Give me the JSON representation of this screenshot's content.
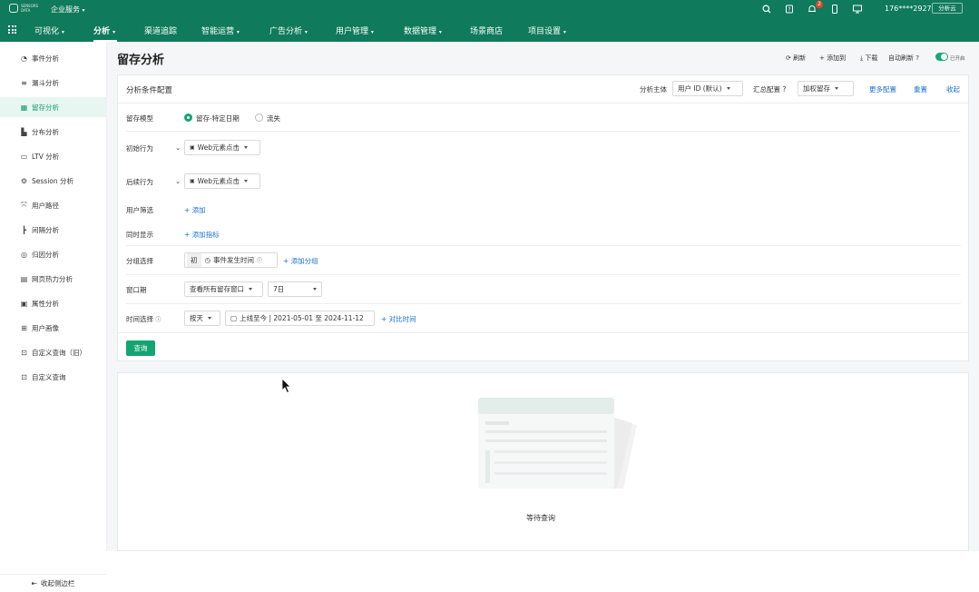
{
  "topbar": {
    "enterprise_label": "企业服务",
    "notification_count": "2",
    "account_text": "176****2927",
    "account_button": "分析云",
    "logo_text": "SENSORS DATA"
  },
  "nav": {
    "items": [
      {
        "label": "可视化"
      },
      {
        "label": "分析"
      },
      {
        "label": "渠道追踪"
      },
      {
        "label": "智能运营"
      },
      {
        "label": "广告分析"
      },
      {
        "label": "用户管理"
      },
      {
        "label": "数据管理"
      },
      {
        "label": "场景商店"
      },
      {
        "label": "项目设置"
      }
    ]
  },
  "sidebar": {
    "items": [
      {
        "label": "事件分析",
        "icon": "event-icon"
      },
      {
        "label": "漏斗分析",
        "icon": "funnel-icon"
      },
      {
        "label": "留存分析",
        "icon": "retention-icon"
      },
      {
        "label": "分布分析",
        "icon": "distribution-icon"
      },
      {
        "label": "LTV 分析",
        "icon": "ltv-icon"
      },
      {
        "label": "Session 分析",
        "icon": "session-icon"
      },
      {
        "label": "用户路径",
        "icon": "path-icon"
      },
      {
        "label": "间隔分析",
        "icon": "interval-icon"
      },
      {
        "label": "归因分析",
        "icon": "attribution-icon"
      },
      {
        "label": "网页热力分析",
        "icon": "heatmap-icon"
      },
      {
        "label": "属性分析",
        "icon": "property-icon"
      },
      {
        "label": "用户画像",
        "icon": "profile-icon"
      },
      {
        "label": "自定义查询（旧）",
        "icon": "custom-query-icon"
      },
      {
        "label": "自定义查询",
        "icon": "custom-query-icon"
      }
    ],
    "collapse_label": "收起侧边栏"
  },
  "page": {
    "title": "留存分析",
    "refresh": "刷新",
    "add_to": "添加到",
    "download": "下载",
    "auto_refresh": "自动刷新",
    "toggle_label": "已开启"
  },
  "config": {
    "header": "分析条件配置",
    "subject_label": "分析主体",
    "subject_value": "用户 ID (默认)",
    "aggregate_label": "汇总配置",
    "aggregate_value": "加权留存",
    "more_config": "更多配置",
    "reset": "重置",
    "collapse": "收起",
    "model_label": "留存模型",
    "model_option_a": "留存-特定日期",
    "model_option_b": "流失",
    "initial_label": "初始行为",
    "initial_value": "Web元素点击",
    "followup_label": "后续行为",
    "followup_value": "Web元素点击",
    "user_filter_label": "用户筛选",
    "add": "添加",
    "simul_label": "同时显示",
    "add_metric": "添加指标",
    "group_label": "分组选择",
    "group_tag": "初",
    "group_value": "事件发生时间",
    "add_group": "添加分组",
    "window_label": "窗口期",
    "window_value": "查看所有留存窗口",
    "window_days": "7日",
    "time_label": "时间选择",
    "time_unit": "按天",
    "date_range": "上线至今 | 2021-05-01 至 2024-11-12",
    "compare_time": "对比时间",
    "query_button": "查询"
  },
  "result": {
    "waiting_text": "等待查询"
  },
  "colors": {
    "brand": "#0f7a5c",
    "accent": "#14a472",
    "link": "#1772c9"
  }
}
